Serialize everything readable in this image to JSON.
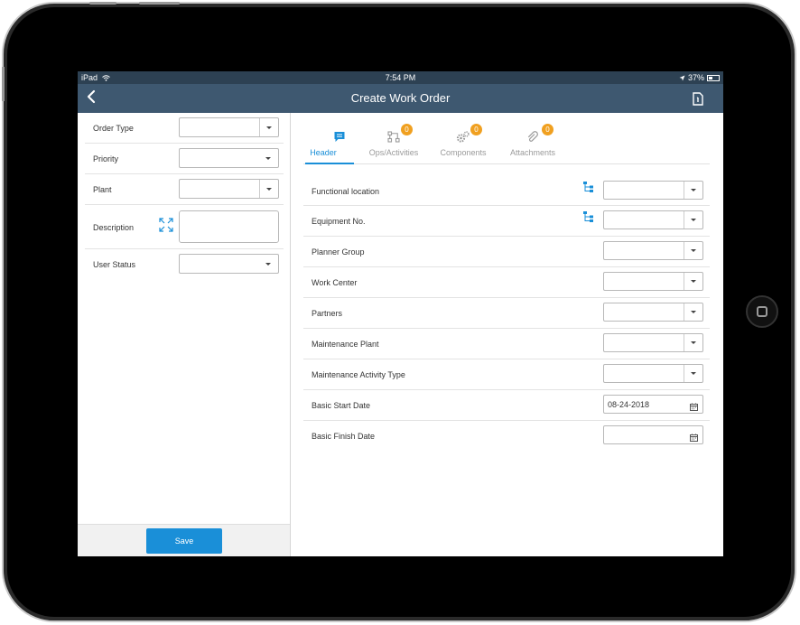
{
  "status_bar": {
    "device": "iPad",
    "time": "7:54 PM",
    "battery": "37%"
  },
  "nav": {
    "title": "Create Work Order",
    "back_icon": "chevron-left-icon",
    "doc_icon": "document-icon"
  },
  "left_panel": {
    "fields": [
      {
        "label": "Order Type",
        "value": ""
      },
      {
        "label": "Priority",
        "value": ""
      },
      {
        "label": "Plant",
        "value": ""
      },
      {
        "label": "Description",
        "value": ""
      },
      {
        "label": "User Status",
        "value": ""
      }
    ],
    "save_label": "Save"
  },
  "tabs": [
    {
      "label": "Header",
      "icon": "comment-icon",
      "badge": ""
    },
    {
      "label": "Ops/Activities",
      "icon": "flow-icon",
      "badge": "0"
    },
    {
      "label": "Components",
      "icon": "gears-icon",
      "badge": "0"
    },
    {
      "label": "Attachments",
      "icon": "paperclip-icon",
      "badge": "0"
    }
  ],
  "header_fields": [
    {
      "label": "Functional  location",
      "value": ""
    },
    {
      "label": "Equipment No.",
      "value": ""
    },
    {
      "label": "Planner Group",
      "value": ""
    },
    {
      "label": "Work Center",
      "value": ""
    },
    {
      "label": "Partners",
      "value": ""
    },
    {
      "label": "Maintenance Plant",
      "value": ""
    },
    {
      "label": "Maintenance Activity Type",
      "value": ""
    },
    {
      "label": "Basic Start Date",
      "value": "08-24-2018"
    },
    {
      "label": "Basic Finish Date",
      "value": ""
    }
  ],
  "colors": {
    "nav": "#3e5870",
    "status": "#2d4153",
    "accent": "#1a8fd8",
    "badge": "#f0a020"
  }
}
